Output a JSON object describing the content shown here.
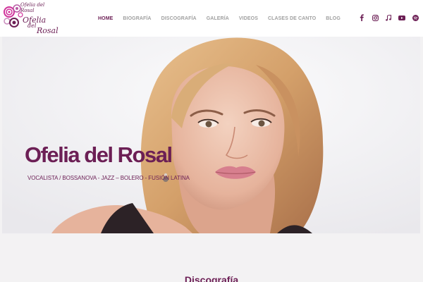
{
  "logo": {
    "line1": "Ofelia del Rosal",
    "ofelia": "Ofelia",
    "del": "del",
    "rosal": "Rosal",
    "brand_color": "#6c1f55"
  },
  "nav": {
    "items": [
      {
        "label": "HOME",
        "active": true
      },
      {
        "label": "BIOGRAFÍA",
        "active": false
      },
      {
        "label": "DISCOGRAFÍA",
        "active": false
      },
      {
        "label": "GALERÍA",
        "active": false
      },
      {
        "label": "VIDEOS",
        "active": false
      },
      {
        "label": "CLASES DE CANTO",
        "active": false
      },
      {
        "label": "BLOG",
        "active": false
      }
    ],
    "active_color": "#6c1f55",
    "inactive_color": "#a0a0a0"
  },
  "social": [
    {
      "icon": "facebook-icon"
    },
    {
      "icon": "instagram-icon"
    },
    {
      "icon": "music-note-icon"
    },
    {
      "icon": "youtube-icon"
    },
    {
      "icon": "spotify-icon"
    }
  ],
  "hero": {
    "title": "Ofelia del Rosal",
    "subtitle": "VOCALISTA / BOSSANOVA - JAZZ – BOLERO - FUSIÓN LATINA"
  },
  "section": {
    "title": "Discografía"
  }
}
